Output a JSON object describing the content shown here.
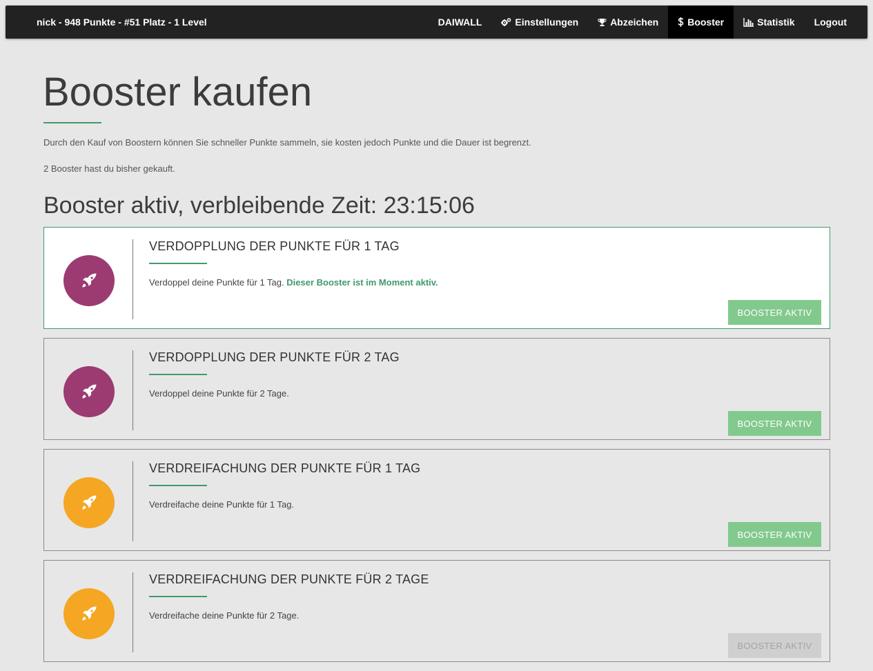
{
  "colors": {
    "accent": "#3f9a6a",
    "navbar": "#222222",
    "button": "#82c98e",
    "button_disabled": "#cfcfcf",
    "purple": "#9b3b71",
    "orange": "#f5a623"
  },
  "nav": {
    "brand": "nick - 948 Punkte - #51 Platz - 1 Level",
    "items": [
      {
        "label": "DAIWALL",
        "icon": "",
        "active": false
      },
      {
        "label": "Einstellungen",
        "icon": "cogs-icon",
        "active": false
      },
      {
        "label": "Abzeichen",
        "icon": "trophy-icon",
        "active": false
      },
      {
        "label": "Booster",
        "icon": "dollar-icon",
        "active": true
      },
      {
        "label": "Statistik",
        "icon": "bar-chart-icon",
        "active": false
      },
      {
        "label": "Logout",
        "icon": "",
        "active": false
      }
    ]
  },
  "page": {
    "title": "Booster kaufen",
    "intro": "Durch den Kauf von Boostern können Sie schneller Punkte sammeln, sie kosten jedoch Punkte und die Dauer ist begrenzt.",
    "count": "2 Booster hast du bisher gekauft.",
    "active_heading": "Booster aktiv, verbleibende Zeit: 23:15:06"
  },
  "boosters": [
    {
      "title": "VERDOPPLUNG DER PUNKTE FÜR 1 TAG",
      "description": "Verdoppel deine Punkte für 1 Tag.",
      "note": "Dieser Booster ist im Moment aktiv.",
      "button": "BOOSTER AKTIV",
      "icon": "rocket-icon",
      "color": "#9b3b71",
      "current": true,
      "button_disabled": false
    },
    {
      "title": "VERDOPPLUNG DER PUNKTE FÜR 2 TAG",
      "description": "Verdoppel deine Punkte für 2 Tage.",
      "note": "",
      "button": "BOOSTER AKTIV",
      "icon": "rocket-icon",
      "color": "#9b3b71",
      "current": false,
      "button_disabled": false
    },
    {
      "title": "VERDREIFACHUNG DER PUNKTE FÜR 1 TAG",
      "description": "Verdreifache deine Punkte für 1 Tag.",
      "note": "",
      "button": "BOOSTER AKTIV",
      "icon": "rocket-icon",
      "color": "#f5a623",
      "current": false,
      "button_disabled": false
    },
    {
      "title": "VERDREIFACHUNG DER PUNKTE FÜR 2 TAGE",
      "description": "Verdreifache deine Punkte für 2 Tage.",
      "note": "",
      "button": "BOOSTER AKTIV",
      "icon": "rocket-icon",
      "color": "#f5a623",
      "current": false,
      "button_disabled": true
    }
  ]
}
